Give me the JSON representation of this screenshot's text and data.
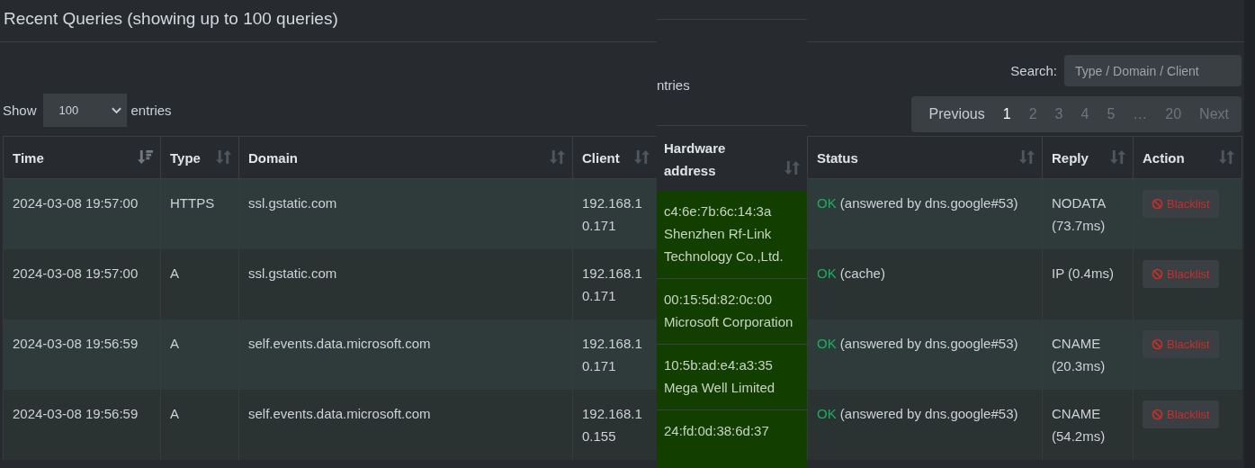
{
  "title": "Recent Queries (showing up to 100 queries)",
  "length_control": {
    "label_before": "Show",
    "value": "100",
    "label_after": "entries"
  },
  "search": {
    "label": "Search:",
    "placeholder": "Type / Domain / Client"
  },
  "pagination": [
    {
      "label": "Previous",
      "kind": "prev",
      "disabled": false
    },
    {
      "label": "1",
      "kind": "page",
      "selected": true
    },
    {
      "label": "2",
      "kind": "page",
      "selected": false
    },
    {
      "label": "3",
      "kind": "page",
      "selected": false
    },
    {
      "label": "4",
      "kind": "page",
      "selected": false
    },
    {
      "label": "5",
      "kind": "page",
      "selected": false
    },
    {
      "label": "…",
      "kind": "ellipsis"
    },
    {
      "label": "20",
      "kind": "page",
      "selected": false
    },
    {
      "label": "Next",
      "kind": "next",
      "disabled": true
    }
  ],
  "table": {
    "columns": [
      {
        "label": "Time",
        "sorted": true
      },
      {
        "label": "Type",
        "sorted": false
      },
      {
        "label": "Domain",
        "sorted": false
      },
      {
        "label": "Client",
        "sorted": false
      },
      {
        "label": "Status",
        "sorted": false
      },
      {
        "label": "Reply",
        "sorted": false
      },
      {
        "label": "Action",
        "sorted": false
      }
    ],
    "rows": [
      {
        "time": "2024-03-08 19:57:00",
        "type": "HTTPS",
        "domain": "ssl.gstatic.com",
        "client": "192.168.10.171",
        "status": "OK",
        "status_detail": "(answered by dns.google#53)",
        "reply": "NODATA (73.7ms)",
        "action": "Blacklist"
      },
      {
        "time": "2024-03-08 19:57:00",
        "type": "A",
        "domain": "ssl.gstatic.com",
        "client": "192.168.10.171",
        "status": "OK",
        "status_detail": "(cache)",
        "reply": "IP (0.4ms)",
        "action": "Blacklist"
      },
      {
        "time": "2024-03-08 19:56:59",
        "type": "A",
        "domain": "self.events.data.microsoft.com",
        "client": "192.168.10.171",
        "status": "OK",
        "status_detail": "(answered by dns.google#53)",
        "reply": "CNAME (20.3ms)",
        "action": "Blacklist"
      },
      {
        "time": "2024-03-08 19:56:59",
        "type": "A",
        "domain": "self.events.data.microsoft.com",
        "client": "192.168.10.155",
        "status": "OK",
        "status_detail": "(answered by dns.google#53)",
        "reply": "CNAME (54.2ms)",
        "action": "Blacklist"
      }
    ]
  },
  "overlay_strip": {
    "fragment": "ntries",
    "column": {
      "label": "Hardware address",
      "sorted": false
    },
    "cells": [
      {
        "mac": "c4:6e:7b:6c:14:3a",
        "vendor": "Shenzhen Rf-Link Technology Co.,Ltd."
      },
      {
        "mac": "00:15:5d:82:0c:00",
        "vendor": "Microsoft Corporation"
      },
      {
        "mac": "10:5b:ad:e4:a3:35",
        "vendor": "Mega Well Limited"
      },
      {
        "mac": "24:fd:0d:38:6d:37"
      }
    ]
  }
}
